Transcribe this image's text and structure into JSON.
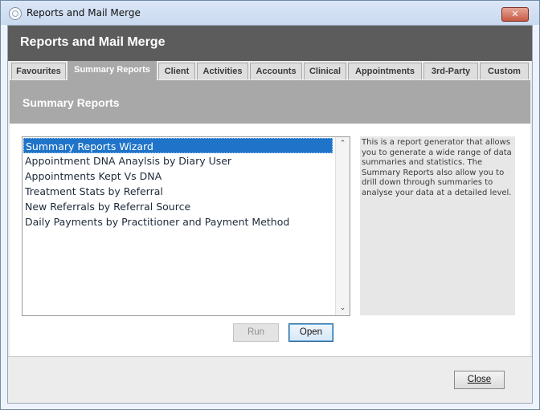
{
  "window": {
    "title": "Reports and Mail Merge",
    "close_glyph": "✕"
  },
  "header": {
    "title": "Reports and Mail Merge"
  },
  "tabs": [
    {
      "label": "Favourites"
    },
    {
      "label": "Summary Reports"
    },
    {
      "label": "Client"
    },
    {
      "label": "Activities"
    },
    {
      "label": "Accounts"
    },
    {
      "label": "Clinical"
    },
    {
      "label": "Appointments"
    },
    {
      "label": "3rd-Party"
    },
    {
      "label": "Custom"
    }
  ],
  "active_tab": "Summary Reports",
  "section": {
    "title": "Summary Reports"
  },
  "reports": [
    {
      "label": "Summary Reports Wizard"
    },
    {
      "label": "Appointment DNA Anaylsis by Diary User"
    },
    {
      "label": "Appointments Kept Vs DNA"
    },
    {
      "label": "Treatment Stats by Referral"
    },
    {
      "label": "New Referrals by Referral Source"
    },
    {
      "label": "Daily Payments by Practitioner and Payment Method"
    }
  ],
  "selected_report": "Summary Reports Wizard",
  "description": "This is a report generator that allows you to generate a wide range of data summaries and statistics. The Summary Reports also allow you to drill down through summaries to analyse your data at a detailed level.",
  "buttons": {
    "run": "Run",
    "open": "Open",
    "close": "Close"
  },
  "scroll": {
    "up": "⌃",
    "down": "⌄"
  },
  "colors": {
    "header": "#5c5c5c",
    "section": "#a8a8a8",
    "selection": "#1f74c9",
    "close_button": "#c85a45"
  }
}
